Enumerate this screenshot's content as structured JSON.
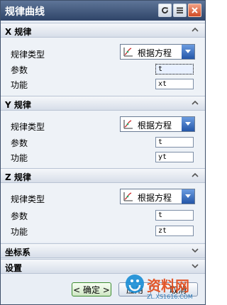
{
  "dialog": {
    "title": "规律曲线"
  },
  "sections": [
    {
      "header": "X 规律",
      "type_label": "规律类型",
      "type_value": "根据方程",
      "param_label": "参数",
      "param_value": "t",
      "func_label": "功能",
      "func_value": "xt"
    },
    {
      "header": "Y 规律",
      "type_label": "规律类型",
      "type_value": "根据方程",
      "param_label": "参数",
      "param_value": "t",
      "func_label": "功能",
      "func_value": "yt"
    },
    {
      "header": "Z 规律",
      "type_label": "规律类型",
      "type_value": "根据方程",
      "param_label": "参数",
      "param_value": "t",
      "func_label": "功能",
      "func_value": "zt"
    }
  ],
  "collapsed": {
    "coord": "坐标系",
    "settings": "设置"
  },
  "footer": {
    "ok": "< 确定 >",
    "apply": "应用",
    "cancel": "取消"
  },
  "watermark": {
    "brand": "资料网",
    "url": "ZL.XS1616.COM"
  },
  "colors": {
    "title_bar": "#2f4468",
    "combo_arrow": "#2456a8",
    "close": "#d14b25"
  }
}
